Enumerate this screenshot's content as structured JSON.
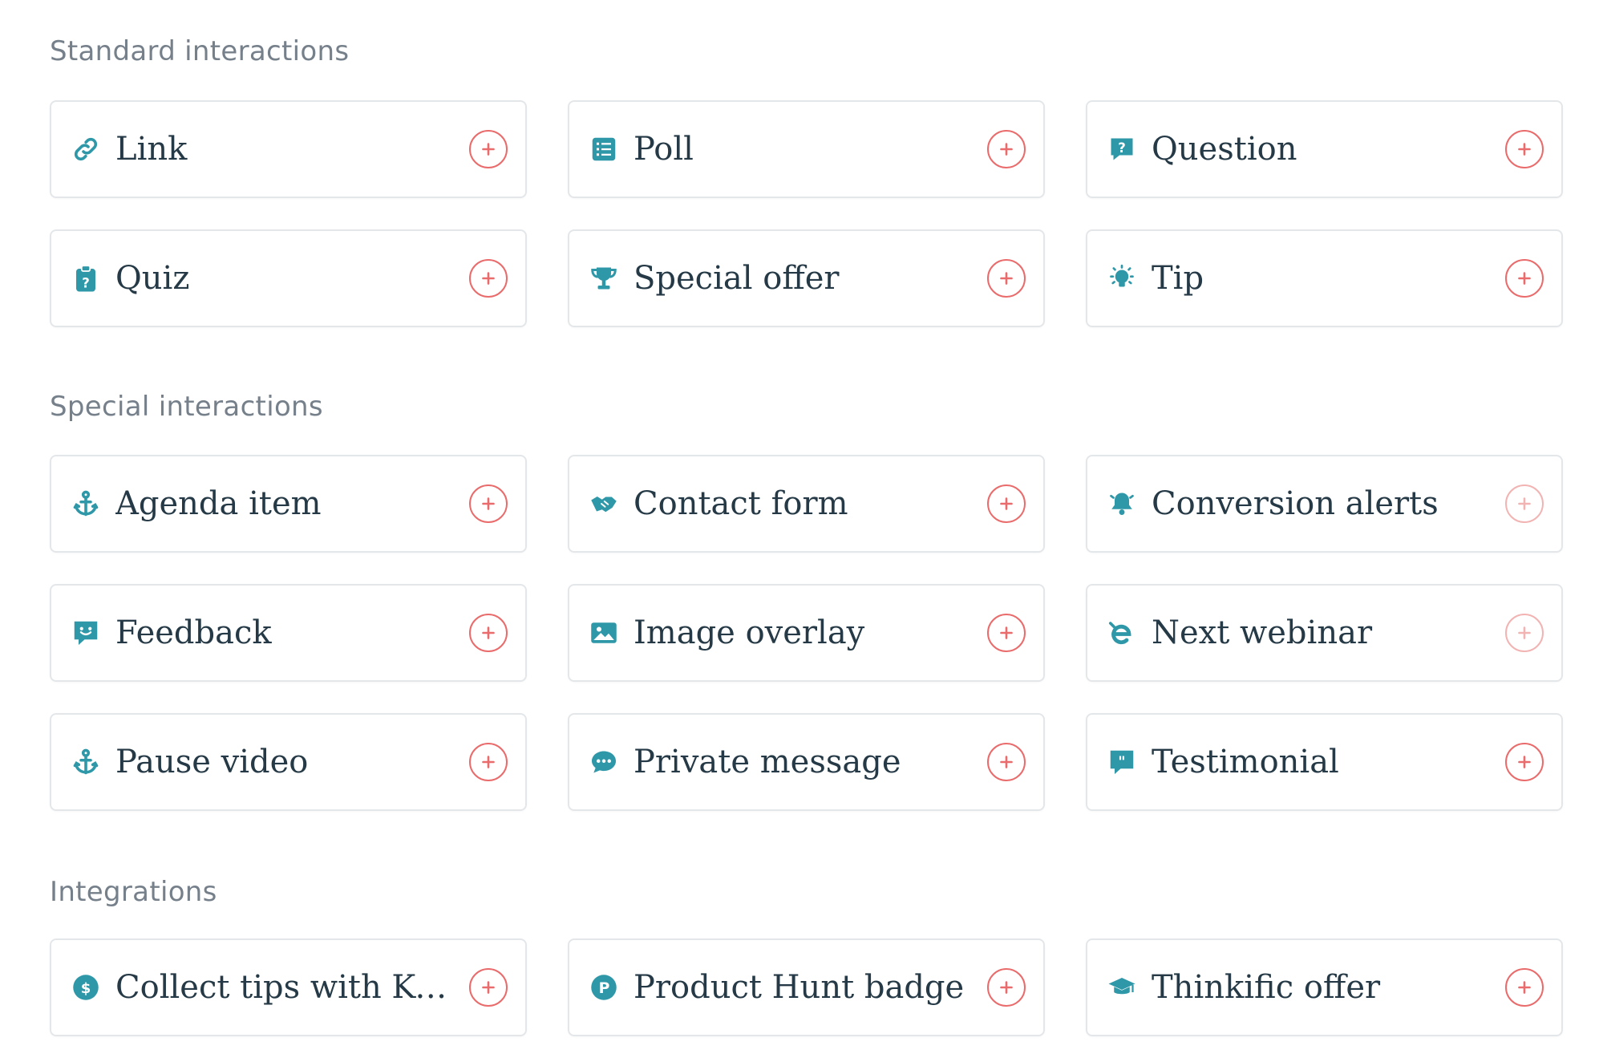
{
  "colors": {
    "accent_icon": "#2f98a8",
    "add_button": "#e96b6b",
    "add_button_faded": "#f2b3b3",
    "heading": "#76808b",
    "label": "#253a46",
    "border": "#e4e7ea"
  },
  "sections": [
    {
      "title": "Standard interactions",
      "items": [
        {
          "label": "Link",
          "icon": "link-icon"
        },
        {
          "label": "Poll",
          "icon": "list-icon"
        },
        {
          "label": "Question",
          "icon": "question-bubble-icon"
        },
        {
          "label": "Quiz",
          "icon": "clipboard-question-icon"
        },
        {
          "label": "Special offer",
          "icon": "trophy-icon"
        },
        {
          "label": "Tip",
          "icon": "lightbulb-icon"
        }
      ]
    },
    {
      "title": "Special interactions",
      "items": [
        {
          "label": "Agenda item",
          "icon": "anchor-icon"
        },
        {
          "label": "Contact form",
          "icon": "handshake-icon"
        },
        {
          "label": "Conversion alerts",
          "icon": "bell-icon",
          "faded": true
        },
        {
          "label": "Feedback",
          "icon": "smile-chat-icon"
        },
        {
          "label": "Image overlay",
          "icon": "image-icon"
        },
        {
          "label": "Next webinar",
          "icon": "e-logo-icon",
          "faded": true
        },
        {
          "label": "Pause video",
          "icon": "anchor-icon"
        },
        {
          "label": "Private message",
          "icon": "chat-dots-icon"
        },
        {
          "label": "Testimonial",
          "icon": "quote-bubble-icon"
        }
      ]
    },
    {
      "title": "Integrations",
      "items": [
        {
          "label": "Collect tips with Ko...",
          "icon": "dollar-circle-icon"
        },
        {
          "label": "Product Hunt badge",
          "icon": "p-circle-icon"
        },
        {
          "label": "Thinkific offer",
          "icon": "graduation-cap-icon"
        }
      ]
    }
  ]
}
